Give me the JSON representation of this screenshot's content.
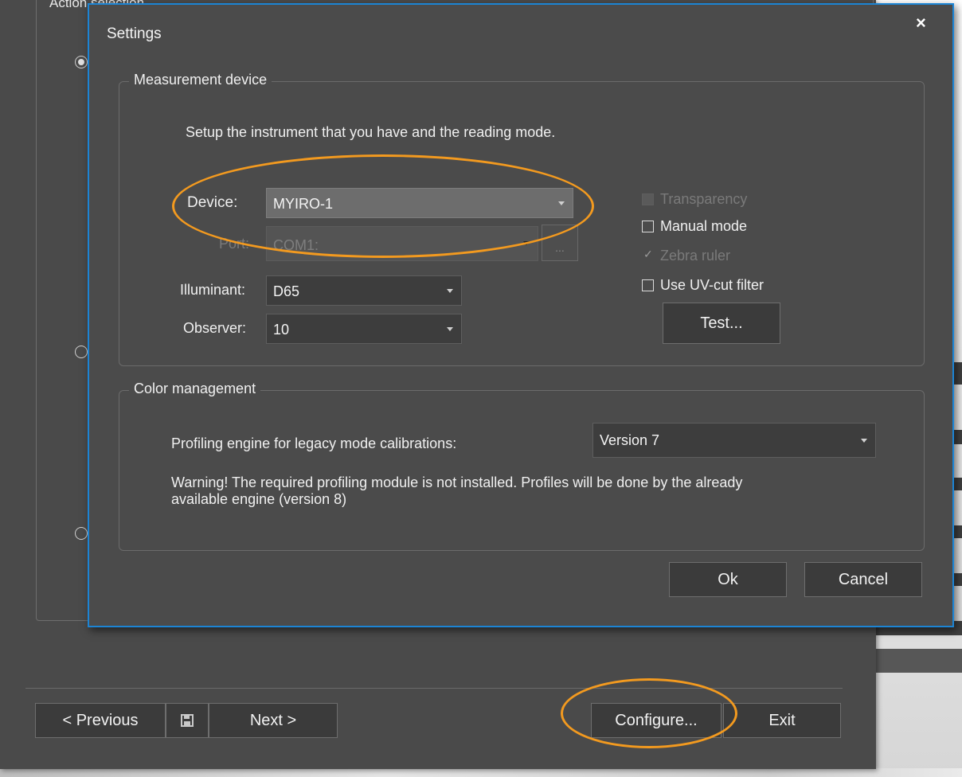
{
  "wizard": {
    "group_label": "Action selection",
    "prev_label": "< Previous",
    "next_label": "Next >",
    "configure_label": "Configure...",
    "exit_label": "Exit"
  },
  "dialog": {
    "title": "Settings",
    "close_symbol": "×",
    "measurement_group": "Measurement device",
    "intro_text": "Setup the instrument that you have and the reading mode.",
    "device_label": "Device:",
    "device_value": "MYIRO-1",
    "port_label": "Port:",
    "port_value": "COM1:",
    "port_button": "...",
    "illuminant_label": "Illuminant:",
    "illuminant_value": "D65",
    "observer_label": "Observer:",
    "observer_value": "10",
    "transparency_label": "Transparency",
    "manual_mode_label": "Manual mode",
    "zebra_ruler_label": "Zebra ruler",
    "uv_cut_label": "Use UV-cut filter",
    "test_label": "Test...",
    "color_group": "Color management",
    "profiling_label": "Profiling engine for legacy mode calibrations:",
    "profiling_value": "Version 7",
    "warning_line1": "Warning! The required profiling module is not installed. Profiles will be done by the already",
    "warning_line2": "available engine (version 8)",
    "ok_label": "Ok",
    "cancel_label": "Cancel"
  },
  "colors": {
    "accent_border": "#1c84d4",
    "highlight": "#f39a1f",
    "background": "#4b4b4b"
  }
}
